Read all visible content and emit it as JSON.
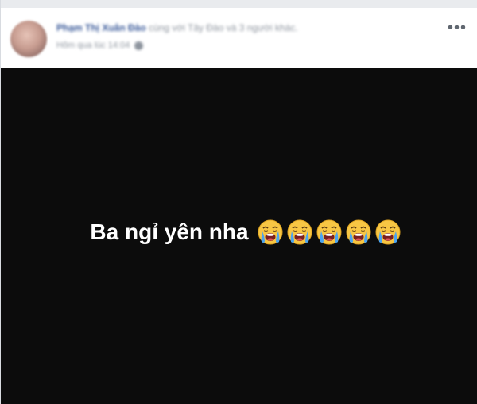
{
  "post": {
    "author": "Phạm Thị Xuân Đào",
    "with_text": "cùng với",
    "tagged_text": "Tây Đào và 3 người khác.",
    "timestamp": "Hôm qua lúc 14:04",
    "privacy_icon": "globe-icon",
    "more_icon": "more-options-icon",
    "more_label": "•••"
  },
  "image": {
    "background_color": "#0c0c0c",
    "caption": "Ba ngỉ yên nha",
    "emoji_name": "loudly-crying-face",
    "emoji_count": 5
  }
}
